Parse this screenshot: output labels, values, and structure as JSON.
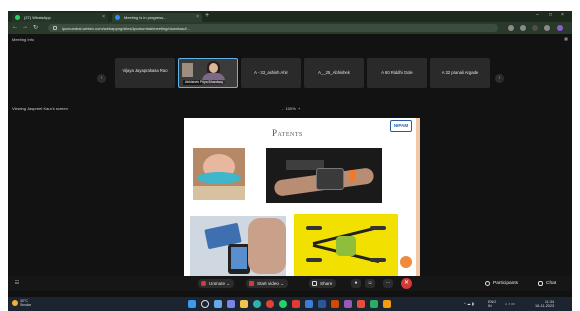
{
  "browser": {
    "tabs": [
      {
        "title": "(27) WhatsApp",
        "favicon_color": "#25d366"
      },
      {
        "title": "Meeting is in progress...",
        "favicon_color": "#2d8cff"
      }
    ],
    "new_tab_label": "+",
    "address": "ipcmumbai.webex.com/webappng/sites/ipcmumbai/meeting/download/..."
  },
  "app": {
    "meeting_info_label": "Meeting Info",
    "participants": [
      {
        "name": "Vijaya Jayaprakasa Rao"
      },
      {
        "name": "Abhishek Priya Bhardwaj",
        "is_self": true
      },
      {
        "name": "A - 33_ashish Ahir"
      },
      {
        "name": "A__25_Abhishek"
      },
      {
        "name": "A 60 Riddhi Gole"
      },
      {
        "name": "A 32 pranali Argade"
      }
    ],
    "viewing_label": "Viewing Jaspreet Kaur's screen",
    "zoom": {
      "minus": "-",
      "value": "100%",
      "plus": "+"
    }
  },
  "slide": {
    "title": "Patents",
    "logo_text": "NIPAM",
    "accent_color": "#f2c9a8"
  },
  "controls": {
    "unmute": "Unmute",
    "start_video": "Start video",
    "share": "Share",
    "leave_symbol": "✕",
    "participants": "Participants",
    "chat": "Chat"
  },
  "taskbar": {
    "weather_temp": "30°C",
    "weather_desc": "Smoke",
    "lang": "ENG",
    "region": "IN",
    "time": "11:34",
    "date": "16-11-2023"
  }
}
